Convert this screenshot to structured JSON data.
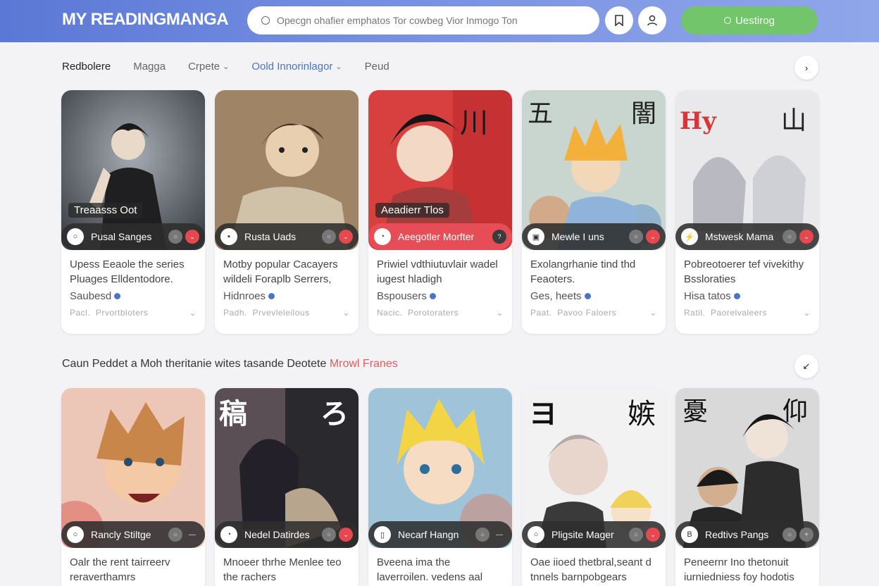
{
  "header": {
    "logo": "MY READINGMANGA",
    "search_placeholder": "Opecgn ohafier emphatos Tor cowbeg Vior Inmogo Ton",
    "login_label": "Uestirog",
    "icons": [
      "bookmark-icon",
      "user-icon"
    ]
  },
  "nav": {
    "items": [
      {
        "label": "Redbolere"
      },
      {
        "label": "Magga"
      },
      {
        "label": "Crpete"
      },
      {
        "label": "Oold Innorinlagor"
      },
      {
        "label": "Peud"
      }
    ]
  },
  "row1": [
    {
      "badge": "Treaasss Oot",
      "pill": "Pusal Sanges",
      "pill_icon": "○",
      "pill_red": false,
      "desc": "Upess Eeaole the series Pluages Elldentodore.",
      "meta": "Saubesd",
      "foot_left": "Pacl.",
      "foot_mid": "Prvortbloters"
    },
    {
      "badge": "",
      "pill": "Rusta Uads",
      "pill_icon": "▪",
      "pill_red": false,
      "desc": "Motby popular Cacayers wildeli Foraplb Serrers,",
      "meta": "Hidnroes",
      "foot_left": "Padh.",
      "foot_mid": "Prvevleleilous"
    },
    {
      "badge": "Aeadierr Tlos",
      "pill": "Aeegotler Morfter",
      "pill_icon": "◔",
      "pill_red": true,
      "desc": "Priwiel vdthiutuvlair wadel iugest hladigh",
      "meta": "Bspousers",
      "foot_left": "Nacic.",
      "foot_mid": "Porotoraters"
    },
    {
      "badge": "",
      "pill": "Mewle I uns",
      "pill_icon": "▣",
      "pill_red": false,
      "desc": "Exolangrhanie tind thd Feaoters.",
      "meta": "Ges, heets",
      "foot_left": "Paat.",
      "foot_mid": "Pavoo Faloers"
    },
    {
      "badge": "",
      "pill": "Mstwesk Mama",
      "pill_icon": "⚡",
      "pill_red": false,
      "desc": "Pobreotoerer tef vivekithy Bssloraties",
      "meta": "Hisa tatos",
      "foot_left": "Ratil.",
      "foot_mid": "Paorelvaleers"
    }
  ],
  "section": {
    "title": "Caun Peddet a Moh theritanie wites tasande Deotete",
    "highlight": "Mrowl Franes"
  },
  "row2": [
    {
      "pill": "Rancly Stiltge",
      "pill_icon": "○",
      "desc": "Oalr the rent tairreerv reraverthamrs"
    },
    {
      "pill": "Nedel Datirdes",
      "pill_icon": "◔",
      "desc": "Mnoeer thrhe Menlee teo the rachers"
    },
    {
      "pill": "Necarf Hangn",
      "pill_icon": "▯",
      "desc": "Bveena ima the laverroilen. vedens aal cavihe radele"
    },
    {
      "pill": "Pligsite Mager",
      "pill_icon": "○",
      "desc": "Oae iioed thetbral,seant d tnnels barnpobgears"
    },
    {
      "pill": "Redtivs Pangs",
      "pill_icon": "B",
      "desc": "Peneernr Ino thetonuit iurniedniess foy hodotis"
    }
  ]
}
